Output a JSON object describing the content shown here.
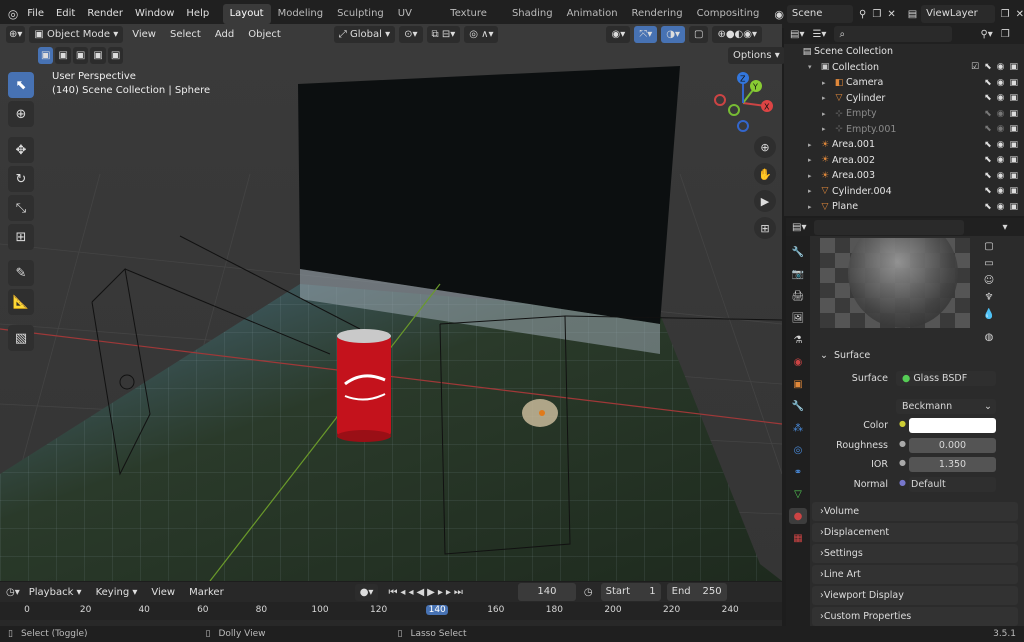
{
  "topbar": {
    "menus": [
      "File",
      "Edit",
      "Render",
      "Window",
      "Help"
    ],
    "workspaces": [
      "Layout",
      "Modeling",
      "Sculpting",
      "UV Editing",
      "Texture Paint",
      "Shading",
      "Animation",
      "Rendering",
      "Compositing"
    ],
    "active_workspace": "Layout",
    "scene": "Scene",
    "view_layer": "ViewLayer"
  },
  "viewport_header": {
    "mode": "Object Mode",
    "menus": [
      "View",
      "Select",
      "Add",
      "Object"
    ],
    "transform": "Global",
    "options": "Options"
  },
  "viewport": {
    "perspective": "User Perspective",
    "collection_info": "(140) Scene Collection | Sphere",
    "gizmo": {
      "x": "X",
      "y": "Y",
      "z": "Z"
    }
  },
  "outliner": {
    "root": "Scene Collection",
    "items": [
      {
        "name": "Collection",
        "indent": 0,
        "icon": "collection-icon",
        "color": "#cccccc"
      },
      {
        "name": "Camera",
        "indent": 1,
        "icon": "camera-icon",
        "color": "#e0883a"
      },
      {
        "name": "Cylinder",
        "indent": 1,
        "icon": "mesh-icon",
        "color": "#e0883a"
      },
      {
        "name": "Empty",
        "indent": 1,
        "icon": "empty-icon",
        "color": "#777777"
      },
      {
        "name": "Empty.001",
        "indent": 1,
        "icon": "empty-icon",
        "color": "#777777"
      },
      {
        "name": "Area.001",
        "indent": 0,
        "icon": "light-icon",
        "color": "#e0883a"
      },
      {
        "name": "Area.002",
        "indent": 0,
        "icon": "light-icon",
        "color": "#e0883a"
      },
      {
        "name": "Area.003",
        "indent": 0,
        "icon": "light-icon",
        "color": "#e0883a"
      },
      {
        "name": "Cylinder.004",
        "indent": 0,
        "icon": "mesh-icon",
        "color": "#e0883a"
      },
      {
        "name": "Plane",
        "indent": 0,
        "icon": "mesh-icon",
        "color": "#e0883a"
      }
    ]
  },
  "properties": {
    "surface_panel": "Surface",
    "surface_label": "Surface",
    "surface_value": "Glass BSDF",
    "distribution": "Beckmann",
    "color_label": "Color",
    "roughness_label": "Roughness",
    "roughness_value": "0.000",
    "ior_label": "IOR",
    "ior_value": "1.350",
    "normal_label": "Normal",
    "normal_value": "Default",
    "subpanels": [
      "Volume",
      "Displacement",
      "Settings",
      "Line Art",
      "Viewport Display",
      "Custom Properties"
    ]
  },
  "timeline": {
    "menus": [
      "Playback",
      "Keying",
      "View",
      "Marker"
    ],
    "current_frame": "140",
    "start_label": "Start",
    "start_value": "1",
    "end_label": "End",
    "end_value": "250",
    "ticks": [
      "0",
      "20",
      "40",
      "60",
      "80",
      "100",
      "120",
      "140",
      "160",
      "180",
      "200",
      "220",
      "240"
    ]
  },
  "statusbar": {
    "select": "Select (Toggle)",
    "dolly": "Dolly View",
    "lasso": "Lasso Select",
    "version": "3.5.1"
  }
}
